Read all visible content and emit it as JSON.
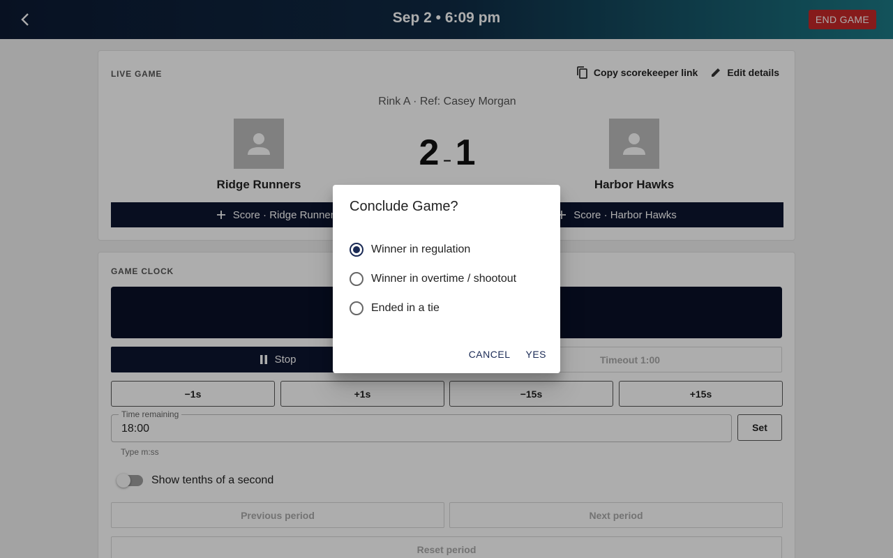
{
  "header": {
    "title": "Sep 2 • 6:09 pm",
    "end_label": "END GAME"
  },
  "live": {
    "section_label": "LIVE GAME",
    "copy_link_label": "Copy scorekeeper link",
    "edit_details_label": "Edit details",
    "venue": "Rink A · Ref: Casey Morgan",
    "home": {
      "name": "Ridge Runners",
      "score": "2",
      "score_button": "Score · Ridge Runners"
    },
    "away": {
      "name": "Harbor Hawks",
      "score": "1",
      "score_button": "Score · Harbor Hawks"
    },
    "score_separator": "–"
  },
  "clock": {
    "section_label": "GAME CLOCK",
    "stop_label": "Stop",
    "timeout_label": "Timeout 1:00",
    "adjust": [
      "−1s",
      "+1s",
      "−15s",
      "+15s"
    ],
    "time_field_label": "Time remaining",
    "time_value": "18:00",
    "set_label": "Set",
    "helper": "Type m:ss",
    "tenths_label": "Show tenths of a second",
    "tenths_on": false,
    "prev_period": "Previous period",
    "next_period": "Next period",
    "reset_period": "Reset period"
  },
  "dialog": {
    "title": "Conclude Game?",
    "options": [
      {
        "label": "Winner in regulation",
        "checked": true
      },
      {
        "label": "Winner in overtime / shootout",
        "checked": false
      },
      {
        "label": "Ended in a tie",
        "checked": false
      }
    ],
    "cancel_label": "CANCEL",
    "yes_label": "YES"
  },
  "colors": {
    "accent": "#0d1530",
    "danger": "#c62828",
    "header_start": "#0d1a33",
    "header_end": "#1c7a86"
  }
}
